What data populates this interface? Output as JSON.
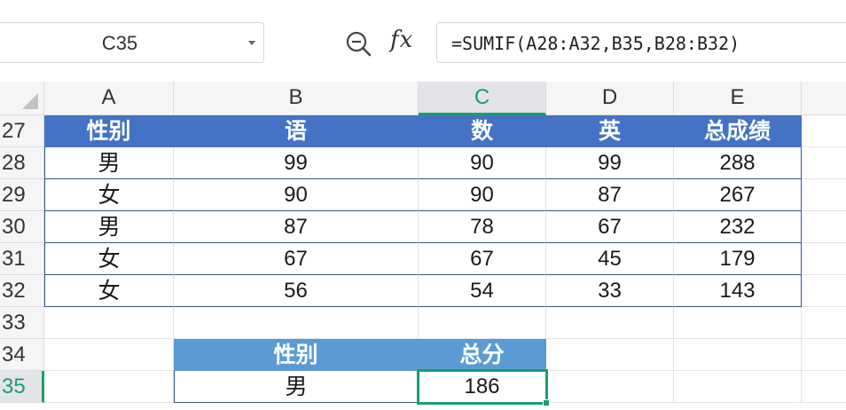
{
  "name_box": {
    "value": "C35"
  },
  "formula_bar": {
    "fx_label": "fx",
    "formula": "=SUMIF(A28:A32,B35,B28:B32)"
  },
  "columns": [
    "A",
    "B",
    "C",
    "D",
    "E"
  ],
  "active_column": "C",
  "active_row": "35",
  "rows": [
    "27",
    "28",
    "29",
    "30",
    "31",
    "32",
    "33",
    "34",
    "35"
  ],
  "table": {
    "headers": [
      "性别",
      "语",
      "数",
      "英",
      "总成绩"
    ],
    "body": [
      [
        "男",
        "99",
        "90",
        "99",
        "288"
      ],
      [
        "女",
        "90",
        "90",
        "87",
        "267"
      ],
      [
        "男",
        "87",
        "78",
        "67",
        "232"
      ],
      [
        "女",
        "67",
        "67",
        "45",
        "179"
      ],
      [
        "女",
        "56",
        "54",
        "33",
        "143"
      ]
    ]
  },
  "summary": {
    "headers": [
      "性别",
      "总分"
    ],
    "values": [
      "男",
      "186"
    ]
  },
  "colors": {
    "table_header": "#4472c4",
    "summary_header": "#5b9bd5",
    "selection": "#1b9e6e"
  }
}
